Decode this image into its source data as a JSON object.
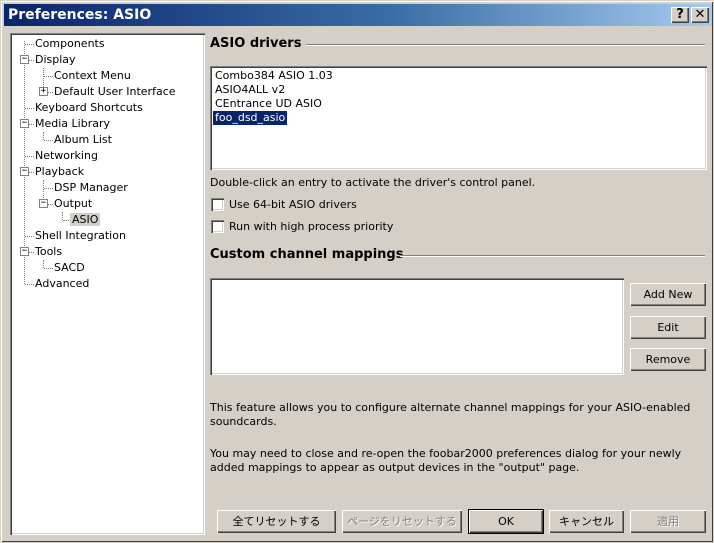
{
  "window": {
    "title": "Preferences: ASIO",
    "help_glyph": "?",
    "close_glyph": "✕"
  },
  "tree": {
    "items": [
      {
        "label": "Components"
      },
      {
        "label": "Display",
        "expander": "−"
      },
      {
        "label": "Context Menu"
      },
      {
        "label": "Default User Interface",
        "expander": "+"
      },
      {
        "label": "Keyboard Shortcuts"
      },
      {
        "label": "Media Library",
        "expander": "−"
      },
      {
        "label": "Album List"
      },
      {
        "label": "Networking"
      },
      {
        "label": "Playback",
        "expander": "−"
      },
      {
        "label": "DSP Manager"
      },
      {
        "label": "Output",
        "expander": "−"
      },
      {
        "label": "ASIO",
        "selected": true
      },
      {
        "label": "Shell Integration"
      },
      {
        "label": "Tools",
        "expander": "−"
      },
      {
        "label": "SACD"
      },
      {
        "label": "Advanced"
      }
    ]
  },
  "asio": {
    "heading": "ASIO drivers",
    "drivers": [
      {
        "label": "Combo384 ASIO 1.03"
      },
      {
        "label": "ASIO4ALL v2"
      },
      {
        "label": "CEntrance UD ASIO"
      },
      {
        "label": "foo_dsd_asio",
        "selected": true
      }
    ],
    "hint": "Double-click an entry to activate the driver's control panel.",
    "use_64bit": {
      "label": "Use 64-bit ASIO drivers",
      "checked": false
    },
    "high_priority": {
      "label": "Run with high process priority",
      "checked": false
    }
  },
  "mappings": {
    "heading": "Custom channel mappings",
    "add_label": "Add New",
    "edit_label": "Edit",
    "remove_label": "Remove",
    "info1_line1": "This feature allows you to configure alternate channel mappings for your ASIO-enabled",
    "info1_line2": "soundcards.",
    "info2_line1": "You may need to close and re-open the foobar2000 preferences dialog for your newly",
    "info2_line2": "added mappings to appear as output devices in the \"output\" page."
  },
  "footer": {
    "reset_all_label": "全てリセットする",
    "reset_page_label": "ページをリセットする",
    "ok_label": "OK",
    "cancel_label": "キャンセル",
    "apply_label": "適用"
  }
}
